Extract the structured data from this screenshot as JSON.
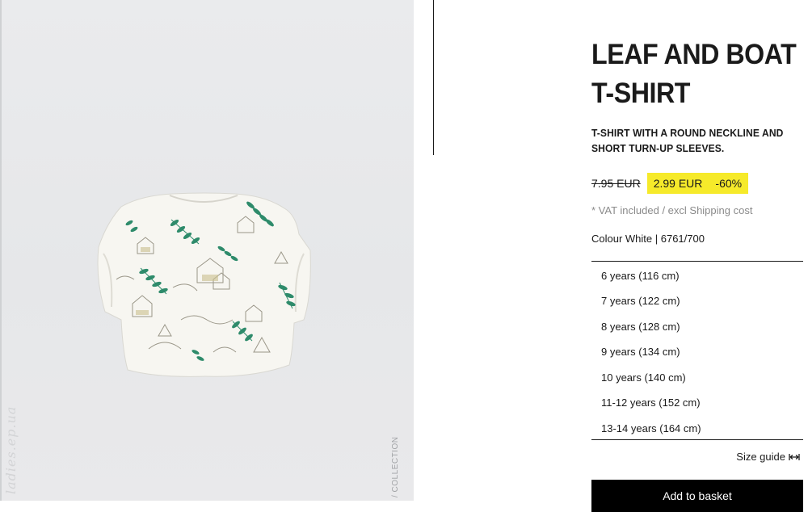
{
  "product": {
    "title_line1": "LEAF AND BOAT",
    "title_line2": "T-SHIRT",
    "description_line1": "T-SHIRT WITH A ROUND NECKLINE AND",
    "description_line2": "SHORT TURN-UP SLEEVES.",
    "old_price": "7.95 EUR",
    "sale_price": "2.99 EUR",
    "discount": "-60%",
    "vat_note": "* VAT included / excl Shipping cost",
    "colour": "Colour White | 6761/700"
  },
  "sizes": [
    "6 years (116 cm)",
    "7 years (122 cm)",
    "8 years (128 cm)",
    "9 years (134 cm)",
    "10 years (140 cm)",
    "11-12 years (152 cm)",
    "13-14 years (164 cm)"
  ],
  "size_guide_label": "Size guide",
  "add_to_basket_label": "Add to basket",
  "image": {
    "watermark": "ladies.ep.ua",
    "vertical_label": "/ COLLECTION"
  },
  "colors": {
    "sale_highlight": "#f6ea2a",
    "button_bg": "#000000",
    "image_bg": "#e8e9eb",
    "print_green": "#2e8b6b"
  }
}
